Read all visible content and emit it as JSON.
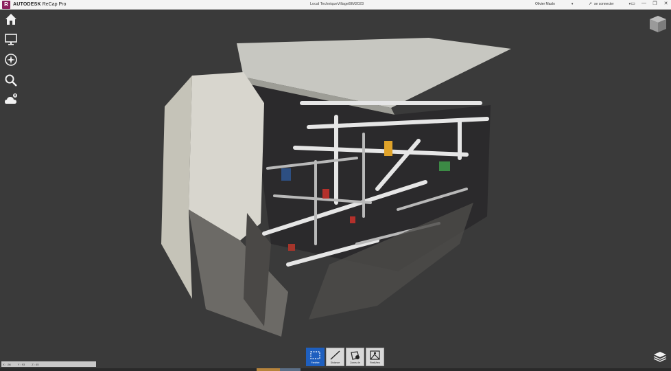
{
  "titlebar": {
    "logo_letter": "R",
    "brand": "AUTODESK",
    "product": "ReCap Pro",
    "document_title": "Local TechniqueVillageBIM2023",
    "user_name": "Olivier Maslo",
    "login_label": "se connecter",
    "caret": "▾",
    "controls": {
      "chat": "▭",
      "minimize": "—",
      "restore": "❐",
      "close": "✕"
    }
  },
  "left_nav": [
    "home-icon",
    "display-settings-icon",
    "navigation-compass-icon",
    "search-icon",
    "cloud-upload-icon"
  ],
  "status_bar": {
    "x_label": "X : -56",
    "y_label": "Y : 93",
    "z_label": "Z : 45"
  },
  "toolbar": {
    "tools": [
      {
        "label": "Fenêtre",
        "icon": "selection-window-icon",
        "active": true
      },
      {
        "label": "Distance",
        "icon": "distance-measure-icon",
        "active": false
      },
      {
        "label": "Zones de",
        "icon": "region-icon",
        "active": false
      },
      {
        "label": "RealView",
        "icon": "realview-icon",
        "active": false
      }
    ]
  },
  "colors": {
    "viewport_bg": "#3a3a3a",
    "accent_active": "#1e5fbf",
    "logo": "#8a1f5c"
  }
}
